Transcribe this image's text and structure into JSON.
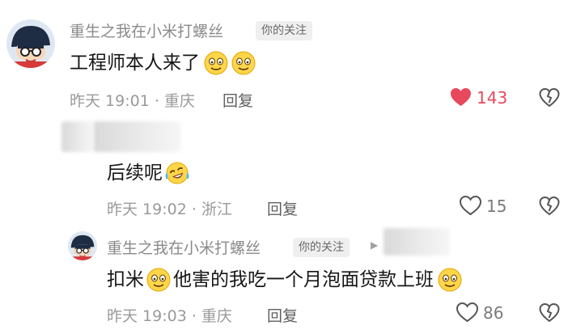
{
  "comments": [
    {
      "username": "重生之我在小米打螺丝",
      "badge": "你的关注",
      "text": "工程师本人来了",
      "meta": "昨天 19:01 · 重庆",
      "reply": "回复",
      "likes": "143",
      "liked": true
    },
    {
      "text": "后续呢",
      "meta": "昨天 19:02 · 浙江",
      "reply": "回复",
      "likes": "15",
      "liked": false
    },
    {
      "username": "重生之我在小米打螺丝",
      "badge": "你的关注",
      "text_part1": "扣米",
      "text_part2": "他害的我吃一个月泡面贷款上班",
      "meta": "昨天 19:03 · 重庆",
      "reply": "回复",
      "likes": "86",
      "liked": false
    }
  ],
  "colors": {
    "like_active": "#e8485c",
    "text_secondary": "#9a9a9a"
  },
  "icons": {
    "smile": "smile-emoji-icon",
    "laugh_cry": "laughing-crying-emoji-icon",
    "heart": "heart-icon",
    "broken_heart": "broken-heart-icon",
    "arrow": "reply-arrow-icon"
  }
}
